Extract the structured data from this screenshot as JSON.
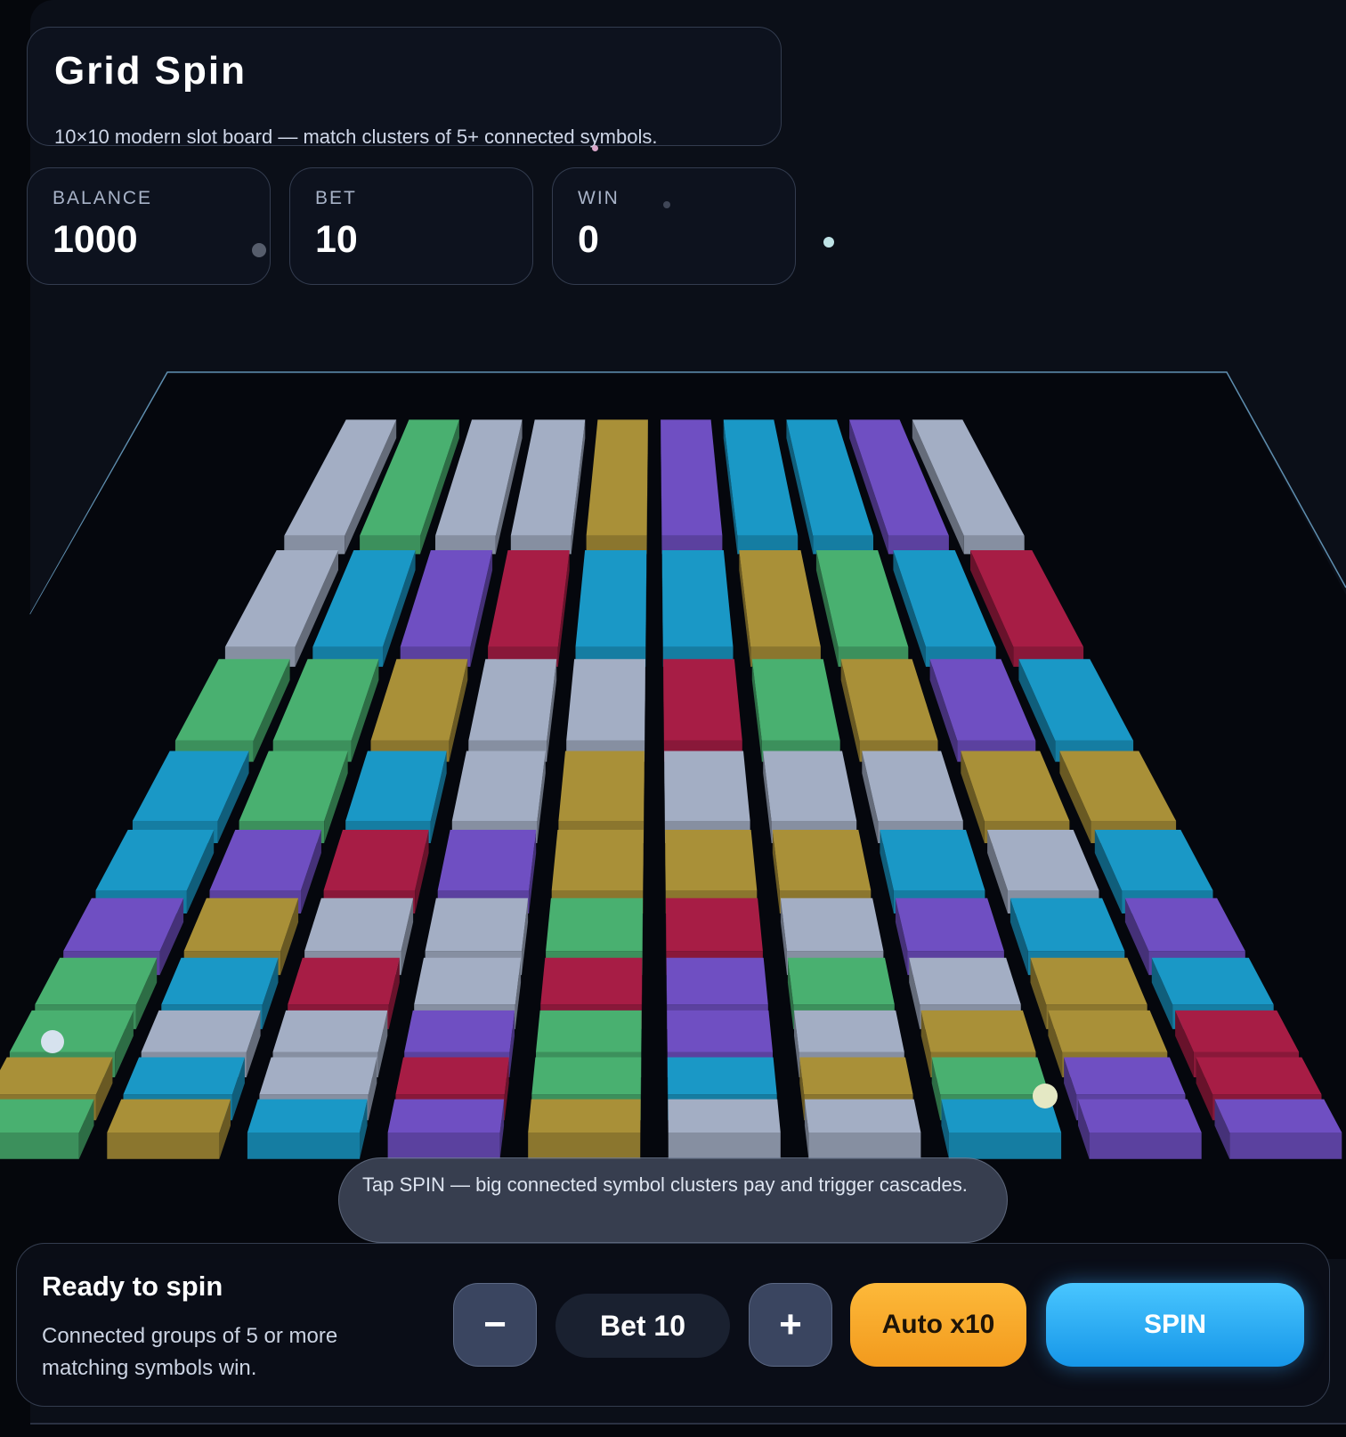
{
  "header": {
    "title": "Grid Spin",
    "subtitle": "10×10 modern slot board — match clusters of 5+ connected symbols."
  },
  "stats": {
    "balance_label": "BALANCE",
    "balance_value": "1000",
    "bet_label": "BET",
    "bet_value": "10",
    "win_label": "WIN",
    "win_value": "0"
  },
  "toast": {
    "message": "Tap SPIN — big connected symbol clusters pay and trigger cascades."
  },
  "controls": {
    "status_title": "Ready to spin",
    "status_hint": "Connected groups of 5 or more matching symbols win.",
    "minus_label": "−",
    "bet_display": "Bet 10",
    "plus_label": "+",
    "auto_label": "Auto x10",
    "spin_label": "SPIN"
  },
  "palette": {
    "silver": "#a3aec4",
    "green": "#49b070",
    "blue": "#1a98c6",
    "purple": "#6f4fc2",
    "gold": "#a99038",
    "red": "#a71d45",
    "accent_spin": "#2fb3f5",
    "accent_auto": "#f7a82a"
  },
  "board": {
    "rows": 10,
    "cols": 10,
    "cells": [
      [
        "silver",
        "green",
        "silver",
        "silver",
        "gold",
        "purple",
        "blue",
        "blue",
        "purple",
        "silver"
      ],
      [
        "silver",
        "blue",
        "purple",
        "red",
        "blue",
        "blue",
        "gold",
        "green",
        "blue",
        "red"
      ],
      [
        "green",
        "green",
        "gold",
        "silver",
        "silver",
        "red",
        "green",
        "gold",
        "purple",
        "blue"
      ],
      [
        "blue",
        "green",
        "blue",
        "silver",
        "gold",
        "silver",
        "silver",
        "silver",
        "gold",
        "gold"
      ],
      [
        "blue",
        "purple",
        "red",
        "purple",
        "gold",
        "gold",
        "gold",
        "blue",
        "silver",
        "blue"
      ],
      [
        "purple",
        "gold",
        "silver",
        "silver",
        "green",
        "red",
        "silver",
        "purple",
        "blue",
        "purple"
      ],
      [
        "green",
        "blue",
        "red",
        "silver",
        "red",
        "purple",
        "green",
        "silver",
        "gold",
        "blue"
      ],
      [
        "green",
        "silver",
        "silver",
        "purple",
        "green",
        "purple",
        "silver",
        "gold",
        "gold",
        "red"
      ],
      [
        "gold",
        "blue",
        "silver",
        "red",
        "green",
        "blue",
        "gold",
        "green",
        "purple",
        "red"
      ],
      [
        "green",
        "gold",
        "blue",
        "purple",
        "gold",
        "silver",
        "silver",
        "blue",
        "purple",
        "purple"
      ]
    ]
  }
}
